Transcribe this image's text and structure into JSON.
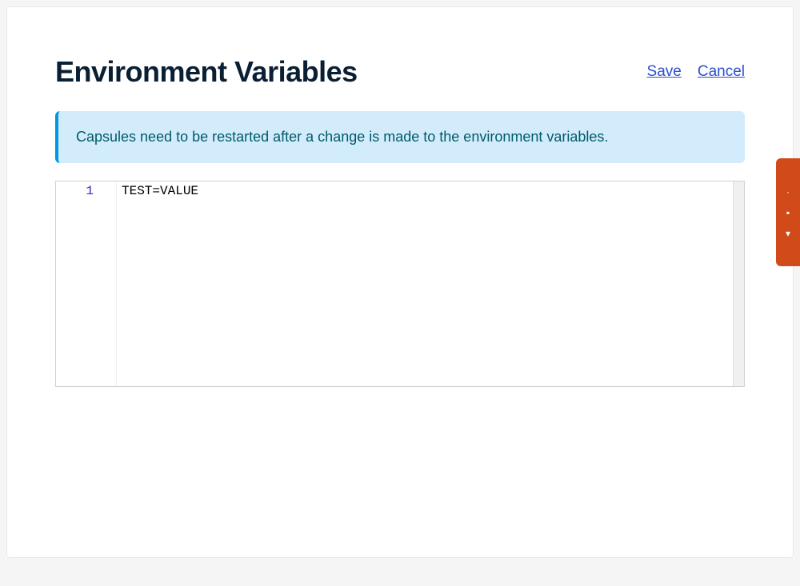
{
  "header": {
    "title": "Environment Variables",
    "save_label": "Save",
    "cancel_label": "Cancel"
  },
  "banner": {
    "message": "Capsules need to be restarted after a change is made to the environment variables."
  },
  "editor": {
    "line_numbers": [
      "1"
    ],
    "content": "TEST=VALUE"
  }
}
